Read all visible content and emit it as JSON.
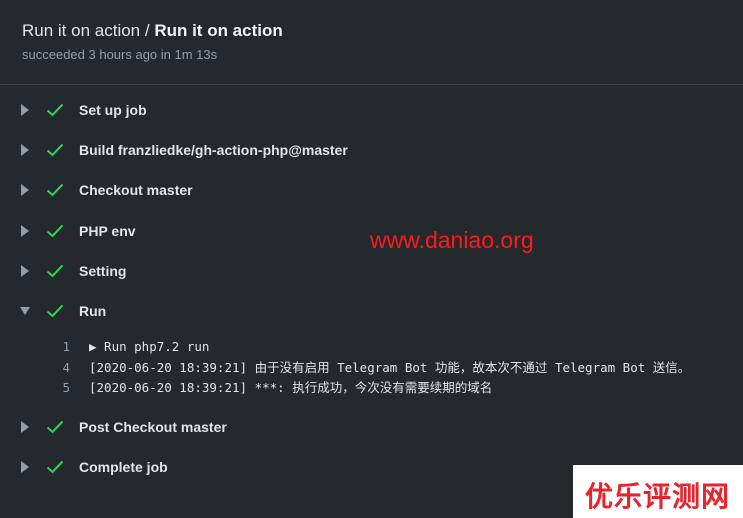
{
  "header": {
    "title_workflow": "Run it on action",
    "title_separator": " / ",
    "title_job": "Run it on action",
    "subtitle": "succeeded 3 hours ago in 1m 13s"
  },
  "steps": [
    {
      "label": "Set up job",
      "status": "success",
      "expanded": false
    },
    {
      "label": "Build franzliedke/gh-action-php@master",
      "status": "success",
      "expanded": false
    },
    {
      "label": "Checkout master",
      "status": "success",
      "expanded": false
    },
    {
      "label": "PHP env",
      "status": "success",
      "expanded": false
    },
    {
      "label": "Setting",
      "status": "success",
      "expanded": false
    },
    {
      "label": "Run",
      "status": "success",
      "expanded": true
    },
    {
      "label": "Post Checkout master",
      "status": "success",
      "expanded": false
    },
    {
      "label": "Complete job",
      "status": "success",
      "expanded": false
    }
  ],
  "run_log": [
    {
      "line": "1",
      "text": "▶ Run php7.2 run"
    },
    {
      "line": "4",
      "text": "[2020-06-20 18:39:21] 由于没有启用 Telegram Bot 功能，故本次不通过 Telegram Bot 送信。"
    },
    {
      "line": "5",
      "text": "[2020-06-20 18:39:21] ***: 执行成功，今次没有需要续期的域名"
    }
  ],
  "watermark": "www.daniao.org",
  "badge": "优乐评测网",
  "colors": {
    "background": "#24292e",
    "success": "#34d058",
    "watermark": "#ff1a1a",
    "badge_text": "#e8232b"
  }
}
